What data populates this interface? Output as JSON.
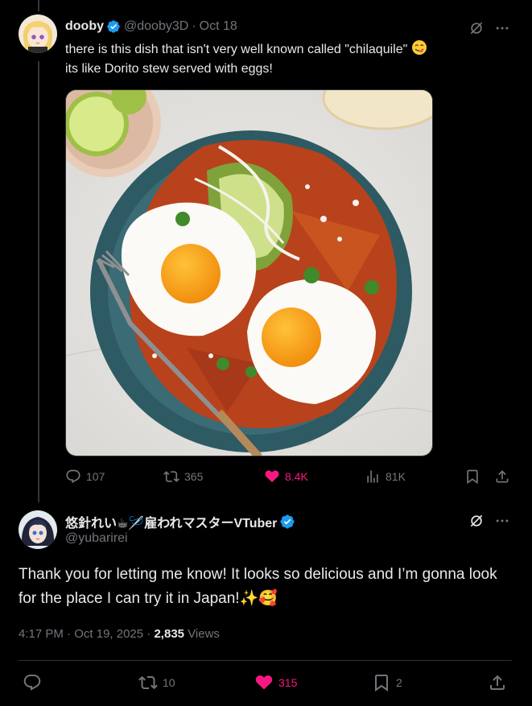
{
  "tweet1": {
    "name": "dooby",
    "handle": "@dooby3D",
    "separator": "·",
    "date": "Oct 18",
    "text_line1": "there is this dish that isn't very well known called \"chilaquile\"",
    "text_line2": "its like Dorito stew served with eggs!",
    "emoji": "yum-face-emoji",
    "photo_alt": "chilaquiles-photo",
    "stats": {
      "replies": "107",
      "reposts": "365",
      "likes": "8.4K",
      "views": "81K"
    }
  },
  "tweet2": {
    "name": "悠針れい☕🪡雇われマスターVTuber",
    "handle": "@yubarirei",
    "text": "Thank you for letting me know! It looks so delicious and I’m gonna look for the place I can try it in Japan!✨🥰",
    "time": "4:17 PM",
    "dot1": "·",
    "date": "Oct 19, 2025",
    "dot2": "·",
    "views_count": "2,835",
    "views_label": "Views",
    "stats": {
      "reposts": "10",
      "likes": "315",
      "bookmarks": "2"
    }
  },
  "colors": {
    "background": "#000000",
    "text": "#e7e9ea",
    "muted": "#71767b",
    "verified": "#1d9bf0",
    "like": "#f91880",
    "divider": "#2f3336"
  },
  "icons": [
    "grok-icon",
    "more-icon",
    "reply-icon",
    "repost-icon",
    "heart-icon",
    "views-icon",
    "bookmark-icon",
    "share-icon",
    "verified-badge-icon"
  ]
}
